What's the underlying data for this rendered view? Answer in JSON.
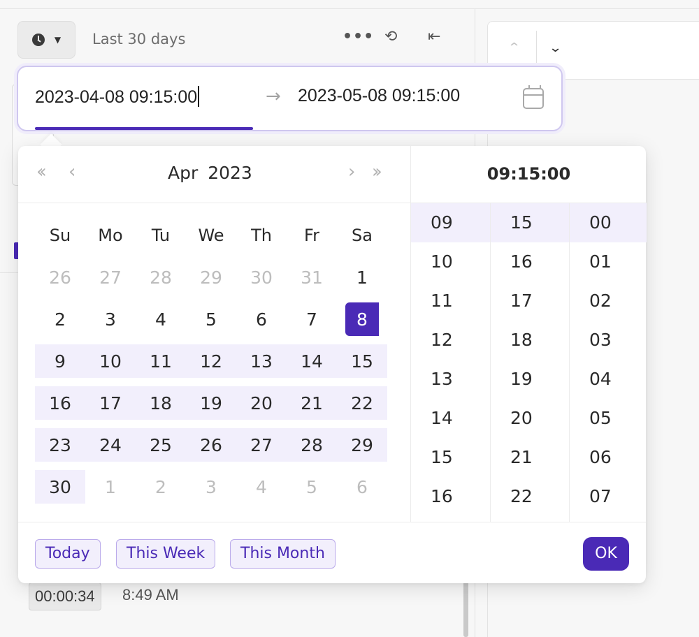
{
  "toolbar": {
    "range_label": "Last 30 days",
    "more_icon": "more-horizontal-icon",
    "sync_icon": "sync-icon",
    "collapse_icon": "collapse-left-icon"
  },
  "range": {
    "start": "2023-04-08 09:15:00",
    "end": "2023-05-08 09:15:00",
    "separator": "→"
  },
  "calendar": {
    "month_year": "Apr  2023",
    "weekdays": [
      "Su",
      "Mo",
      "Tu",
      "We",
      "Th",
      "Fr",
      "Sa"
    ],
    "rows": [
      [
        "26",
        "27",
        "28",
        "29",
        "30",
        "31",
        "1"
      ],
      [
        "2",
        "3",
        "4",
        "5",
        "6",
        "7",
        "8"
      ],
      [
        "9",
        "10",
        "11",
        "12",
        "13",
        "14",
        "15"
      ],
      [
        "16",
        "17",
        "18",
        "19",
        "20",
        "21",
        "22"
      ],
      [
        "23",
        "24",
        "25",
        "26",
        "27",
        "28",
        "29"
      ],
      [
        "30",
        "1",
        "2",
        "3",
        "4",
        "5",
        "6"
      ]
    ]
  },
  "time": {
    "header": "09:15:00",
    "hours": [
      "09",
      "10",
      "11",
      "12",
      "13",
      "14",
      "15",
      "16"
    ],
    "minutes": [
      "15",
      "16",
      "17",
      "18",
      "19",
      "20",
      "21",
      "22"
    ],
    "seconds": [
      "00",
      "01",
      "02",
      "03",
      "04",
      "05",
      "06",
      "07"
    ]
  },
  "footer": {
    "today": "Today",
    "this_week": "This Week",
    "this_month": "This Month",
    "ok": "OK"
  },
  "background": {
    "duration": "00:00:34",
    "time": "8:49 AM"
  },
  "colors": {
    "accent": "#4a2ab6",
    "range_bg": "#f2effc"
  }
}
